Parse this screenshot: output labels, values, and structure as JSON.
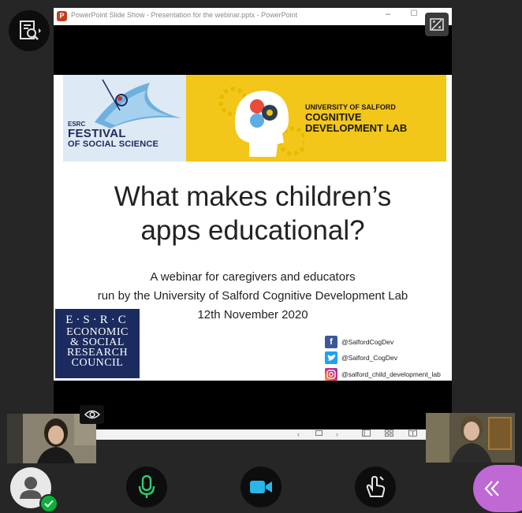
{
  "window": {
    "title": "PowerPoint Slide Show  -  Presentation for the webinar.pptx  -  PowerPoint",
    "app_icon_letter": "P",
    "minimize_glyph": "–",
    "maximize_glyph": "☐"
  },
  "slide": {
    "esrc_small": "ESRC",
    "festival_line1": "FESTIVAL",
    "festival_line2": "OF SOCIAL SCIENCE",
    "uni_line1": "UNIVERSITY OF SALFORD",
    "uni_line2": "COGNITIVE",
    "uni_line3": "DEVELOPMENT LAB",
    "title_line1": "What makes children’s",
    "title_line2": "apps educational?",
    "subtitle_line1": "A webinar for caregivers and educators",
    "subtitle_line2": "run by the University of Salford Cognitive Development Lab",
    "subtitle_line3": "12th November 2020",
    "esrc_logo": {
      "line1": "E·S·R·C",
      "line2": "ECONOMIC",
      "line3": "& SOCIAL",
      "line4": "RESEARCH",
      "line5": "COUNCIL"
    },
    "social": {
      "facebook": "@SalfordCogDev",
      "twitter": "@Salford_CogDev",
      "instagram": "@salford_child_development_lab"
    }
  },
  "slideshow_bar": {
    "prev_glyph": "‹",
    "next_glyph": "›"
  },
  "colors": {
    "background": "#262626",
    "accent_collapse": "#c069d4",
    "mic": "#2ecc71",
    "video": "#29b6e8",
    "status_ok": "#0ab03a",
    "banner_yellow": "#f3c61a",
    "esrc_navy": "#1c2b5f"
  },
  "icons": [
    "details-search-icon",
    "fullscreen-icon",
    "eye-icon",
    "avatar-icon",
    "check-icon",
    "microphone-icon",
    "video-camera-icon",
    "share-hand-icon",
    "chevron-left-double-icon"
  ]
}
